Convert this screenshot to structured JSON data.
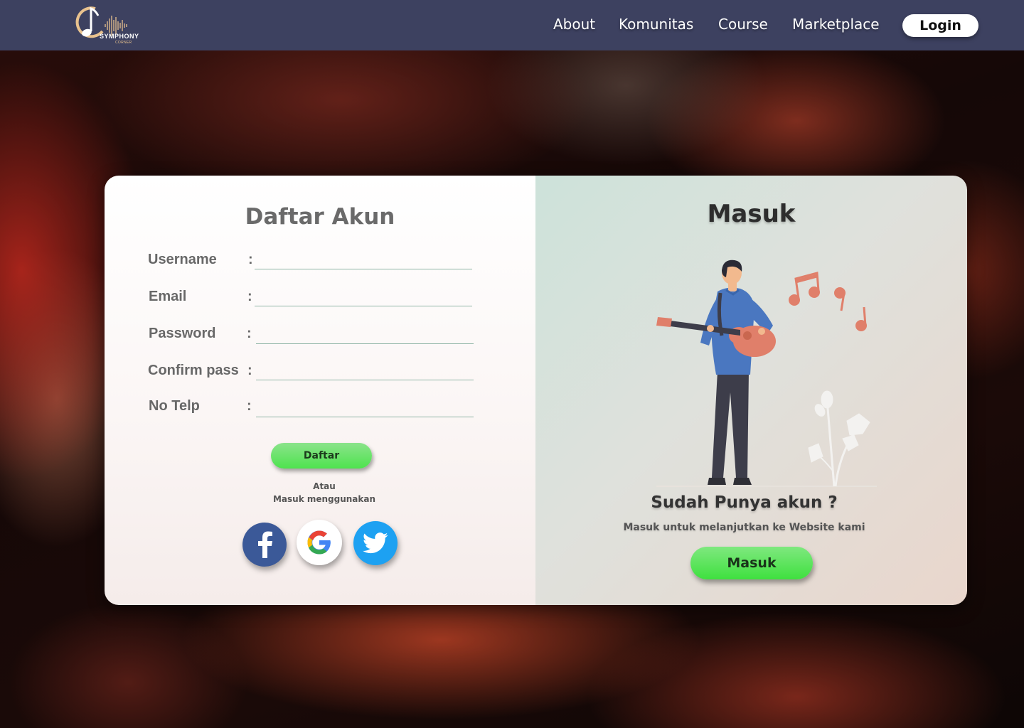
{
  "nav": {
    "logo_text": "SYMPHONY",
    "logo_subtext": "CORNER",
    "links": [
      "About",
      "Komunitas",
      "Course",
      "Marketplace"
    ],
    "login_label": "Login"
  },
  "register": {
    "title": "Daftar Akun",
    "fields": [
      {
        "label": "Username",
        "value": "",
        "placeholder": ""
      },
      {
        "label": "Email",
        "value": "",
        "placeholder": ""
      },
      {
        "label": "Password",
        "value": "",
        "placeholder": ""
      },
      {
        "label": "Confirm pass",
        "value": "",
        "placeholder": ""
      },
      {
        "label": "No Telp",
        "value": "",
        "placeholder": ""
      }
    ],
    "colon": ":",
    "submit_label": "Daftar",
    "alt_line1": "Atau",
    "alt_line2": "Masuk menggunakan",
    "social": [
      "facebook-icon",
      "google-icon",
      "twitter-icon"
    ]
  },
  "login_panel": {
    "title": "Masuk",
    "question": "Sudah Punya akun ?",
    "subtitle": "Masuk untuk melanjutkan ke Website kami",
    "button_label": "Masuk"
  },
  "colors": {
    "navbar": "#3d4160",
    "accent_green": "#4ee34e",
    "illustration_blue": "#4a77c0",
    "illustration_coral": "#e07f6a"
  }
}
